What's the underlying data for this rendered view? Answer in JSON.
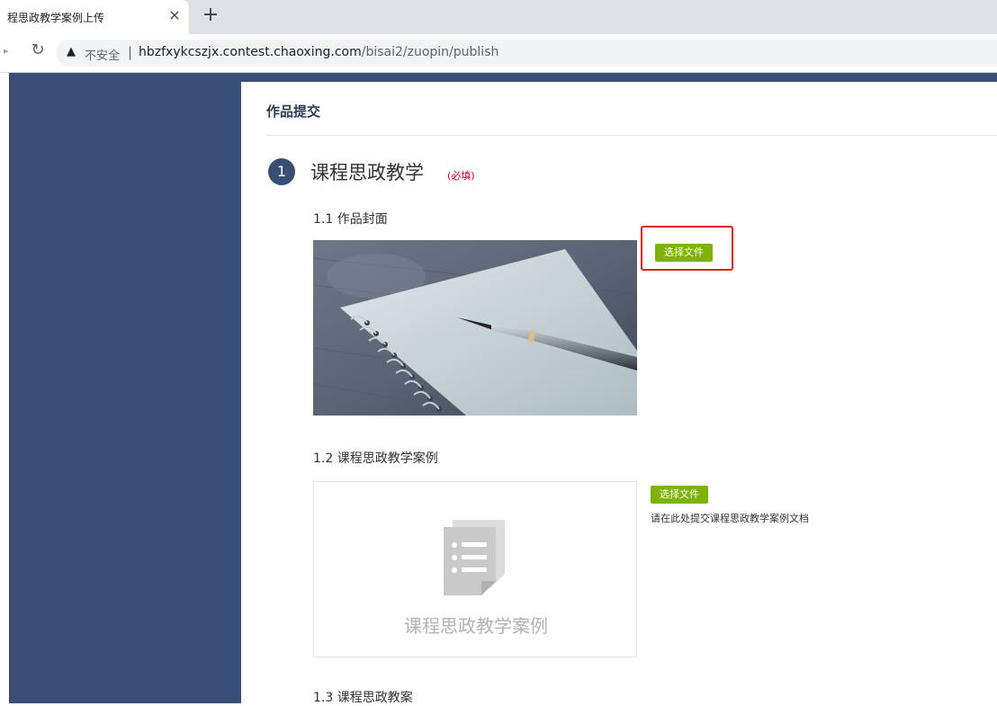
{
  "browser": {
    "tab_title": "程思政教学案例上传",
    "tab_close": "×",
    "new_tab": "+",
    "insecure_label": "不安全",
    "url_host": "hbzfxykcszjx.contest.chaoxing.com",
    "url_path": "/bisai2/zuopin/publish"
  },
  "page": {
    "title": "作品提交",
    "step": {
      "number": "1",
      "title": "课程思政教学",
      "required": "(必填)"
    },
    "sections": [
      {
        "label": "1.1 作品封面",
        "button": "选择文件"
      },
      {
        "label": "1.2 课程思政教学案例",
        "button": "选择文件",
        "hint": "请在此处提交课程思政教学案例文档",
        "placeholder": "课程思政教学案例"
      },
      {
        "label": "1.3 课程思政教案"
      }
    ]
  },
  "colors": {
    "sidebar": "#394f73",
    "button_green": "#7cb305",
    "highlight_red": "#e0201c",
    "required_red": "#d0021b"
  }
}
